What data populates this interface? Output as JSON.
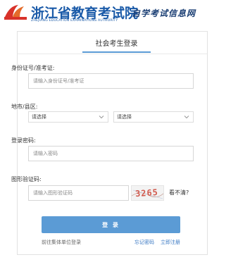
{
  "header": {
    "title": "浙江省教育考试院",
    "subtitle": "ZHEJIANG EDUCATION EXAMINATIONS AUTHORITY",
    "slogan": "自学考试信息网",
    "logo_icon": "zjzs-logo-icon"
  },
  "login": {
    "tab_label": "社会考生登录",
    "id_label": "身份证号/准考证:",
    "id_placeholder": "请输入身份证号/准考证",
    "region_label": "地市/县区:",
    "city_select": "请选择",
    "district_select": "请选择",
    "password_label": "登录密码:",
    "password_placeholder": "请输入密码",
    "captcha_label": "图形验证码:",
    "captcha_placeholder": "请输入图形验证码",
    "captcha_text": "3265",
    "refresh_label": "看不清?",
    "submit_label": "登 录",
    "group_link": "前往集体单位登录",
    "forgot_link": "忘记密码",
    "register_link": "立即注册"
  },
  "colors": {
    "accent": "#5b9bd5",
    "title_blue": "#1a5aa8",
    "link_blue": "#3a78c3"
  }
}
